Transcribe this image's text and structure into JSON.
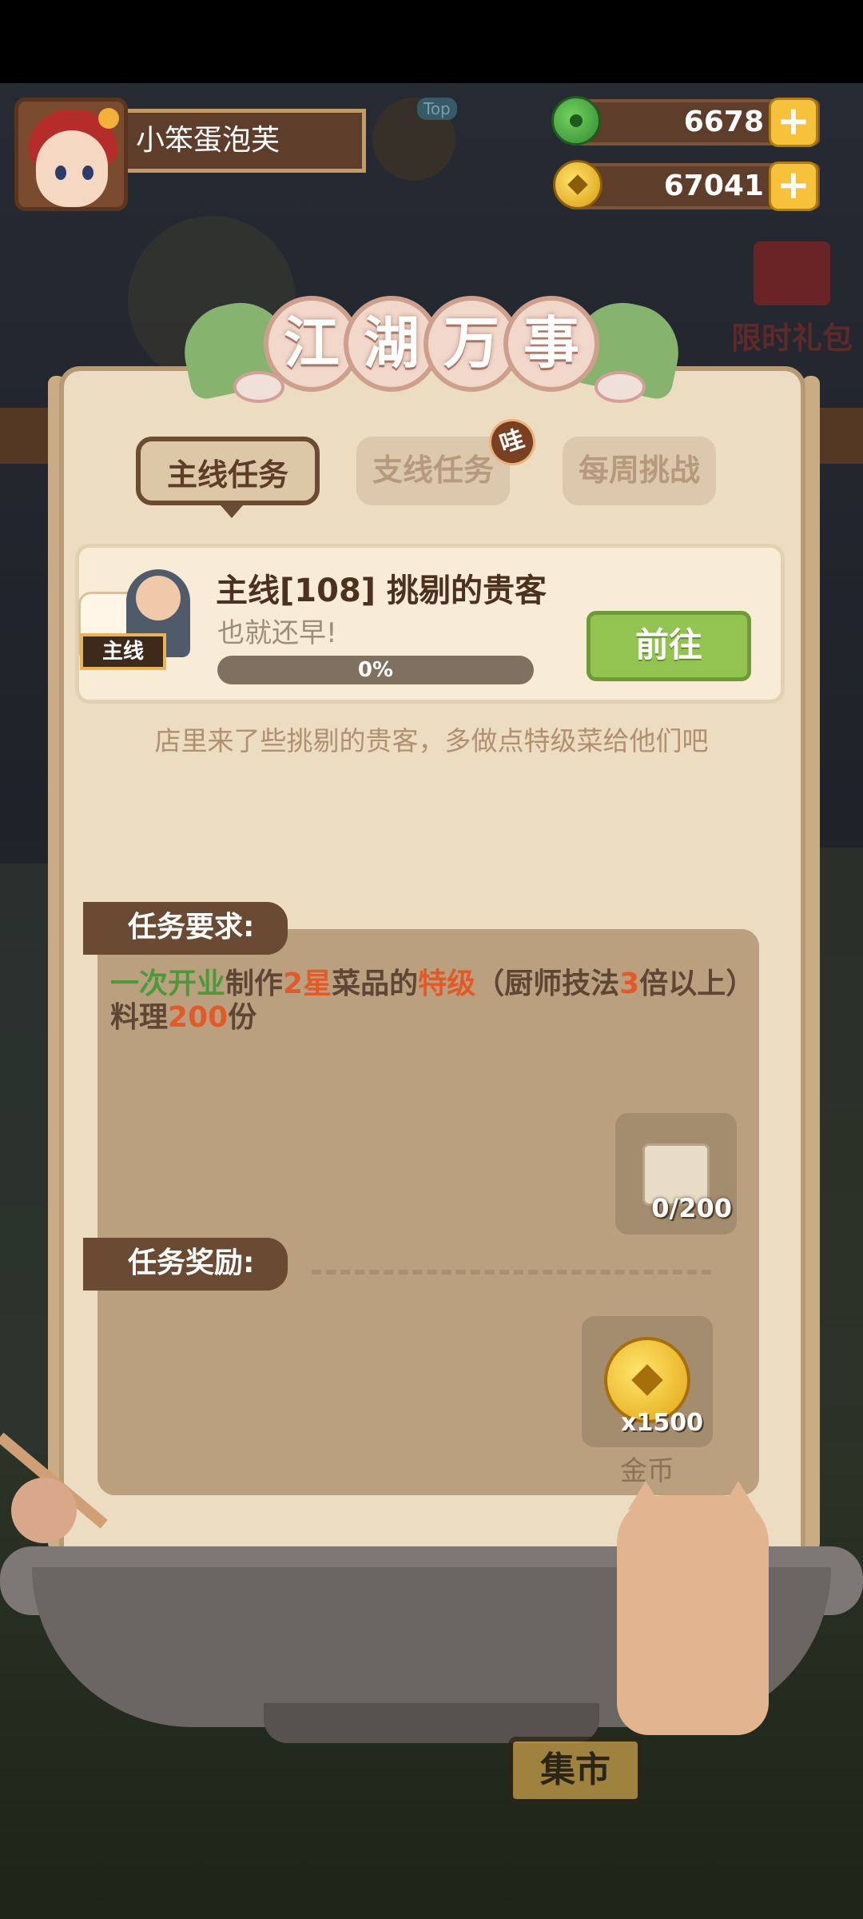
{
  "player": {
    "name": "小笨蛋泡芙",
    "top_tag": "Top"
  },
  "resources": {
    "jade": "6678",
    "coins": "67041"
  },
  "gift_pack": "限时礼包",
  "panel": {
    "title_chars": [
      "江",
      "湖",
      "万",
      "事"
    ],
    "tabs": [
      {
        "label": "主线任务",
        "active": true
      },
      {
        "label": "支线任务",
        "active": false,
        "badge": "哇"
      },
      {
        "label": "每周挑战",
        "active": false
      }
    ]
  },
  "quest": {
    "tag": "主线",
    "title": "主线[108] 挑剔的贵客",
    "subtitle": "也就还早!",
    "progress_label": "0%",
    "progress": 0,
    "go_label": "前往",
    "description": "店里来了些挑剔的贵客，多做点特级菜给他们吧"
  },
  "requirements": {
    "header": "任务要求:",
    "parts": [
      {
        "text": "一次开业",
        "color": "green"
      },
      {
        "text": "制作",
        "color": "normal"
      },
      {
        "text": "2星",
        "color": "orange"
      },
      {
        "text": "菜品的",
        "color": "normal"
      },
      {
        "text": "特级",
        "color": "orange"
      },
      {
        "text": "（厨师技法",
        "color": "normal"
      },
      {
        "text": "3",
        "color": "orange"
      },
      {
        "text": "倍以上）料理",
        "color": "normal"
      },
      {
        "text": "200",
        "color": "orange"
      },
      {
        "text": "份",
        "color": "normal"
      }
    ],
    "item_count": "0/200"
  },
  "rewards": {
    "header": "任务奖励:",
    "items": [
      {
        "icon": "gold-coin-icon",
        "count": "x1500",
        "name": "金币"
      }
    ]
  },
  "market_sign": "集市",
  "colors": {
    "accent_green": "#93c451",
    "highlight_orange": "#e25a28",
    "highlight_green": "#4a9a3a",
    "panel_bg": "#ecdcc1",
    "header_brown": "#6a4a32"
  }
}
